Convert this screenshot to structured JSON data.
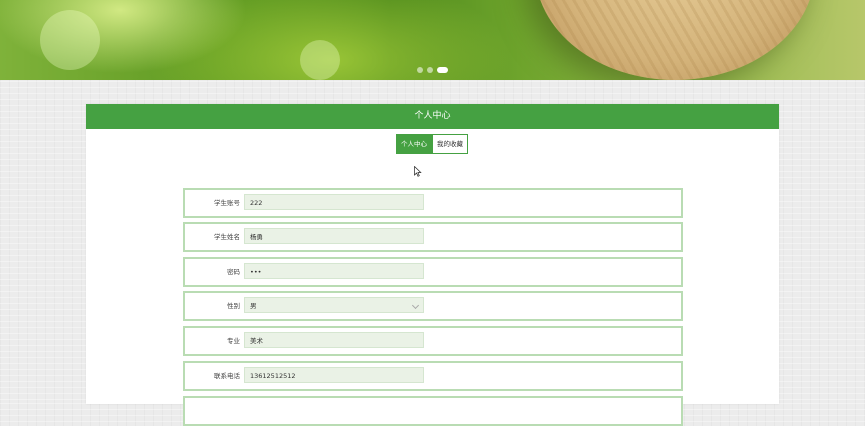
{
  "banner": {
    "dots": 3,
    "active_dot": 2
  },
  "panel": {
    "title": "个人中心",
    "tabs": [
      {
        "label": "个人中心",
        "active": true
      },
      {
        "label": "我的收藏",
        "active": false
      }
    ]
  },
  "form": {
    "fields": [
      {
        "label": "学生账号",
        "value": "222",
        "type": "text"
      },
      {
        "label": "学生姓名",
        "value": "杨勇",
        "type": "text"
      },
      {
        "label": "密码",
        "value": "•••",
        "type": "password"
      },
      {
        "label": "性别",
        "value": "男",
        "type": "select"
      },
      {
        "label": "专业",
        "value": "美术",
        "type": "text"
      },
      {
        "label": "联系电话",
        "value": "13612512512",
        "type": "text"
      }
    ]
  },
  "colors": {
    "accent": "#45a142",
    "row_border": "#b9dcb3",
    "field_bg": "#eaf2e6"
  }
}
